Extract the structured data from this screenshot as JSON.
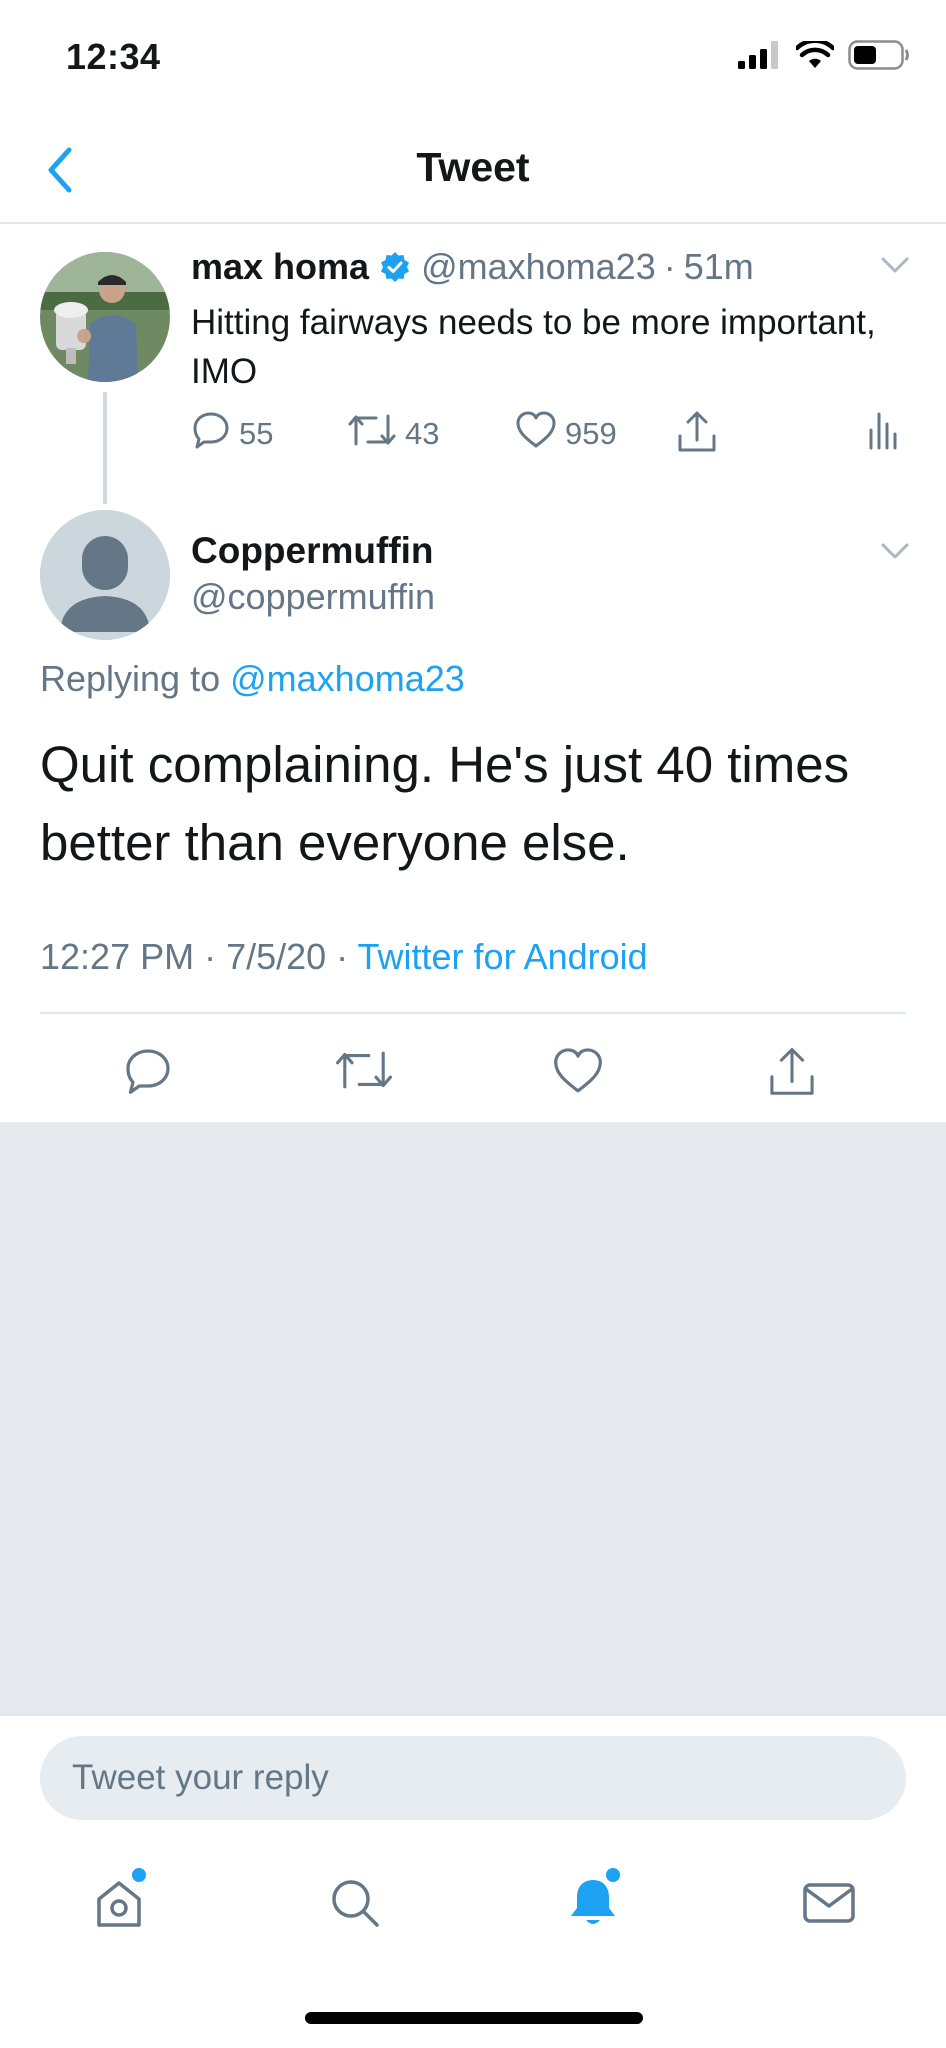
{
  "status_bar": {
    "time": "12:34"
  },
  "nav": {
    "title": "Tweet"
  },
  "parent_tweet": {
    "name": "max homa",
    "handle": "@maxhoma23",
    "separator": "·",
    "time": "51m",
    "text": "Hitting fairways needs to be more important, IMO",
    "replies": "55",
    "retweets": "43",
    "likes": "959"
  },
  "main_tweet": {
    "name": "Coppermuffin",
    "handle": "@coppermuffin",
    "replying_prefix": "Replying to",
    "replying_to": "@maxhoma23",
    "text": "Quit complaining. He's just 40 times better than everyone else.",
    "timestamp": "12:27 PM · 7/5/20 ·",
    "source": "Twitter for Android"
  },
  "reply": {
    "placeholder": "Tweet your reply"
  },
  "colors": {
    "accent": "#1da1f2",
    "secondary_text": "#657786",
    "background_gray": "#e6e9ee"
  },
  "icons": {
    "back": "chevron-left-icon",
    "verified": "verified-badge-icon",
    "reply": "comment-icon",
    "retweet": "retweet-icon",
    "like": "heart-icon",
    "share": "share-icon",
    "analytics": "analytics-icon",
    "home": "home-icon",
    "search": "search-icon",
    "notifications": "bell-icon",
    "messages": "mail-icon"
  }
}
